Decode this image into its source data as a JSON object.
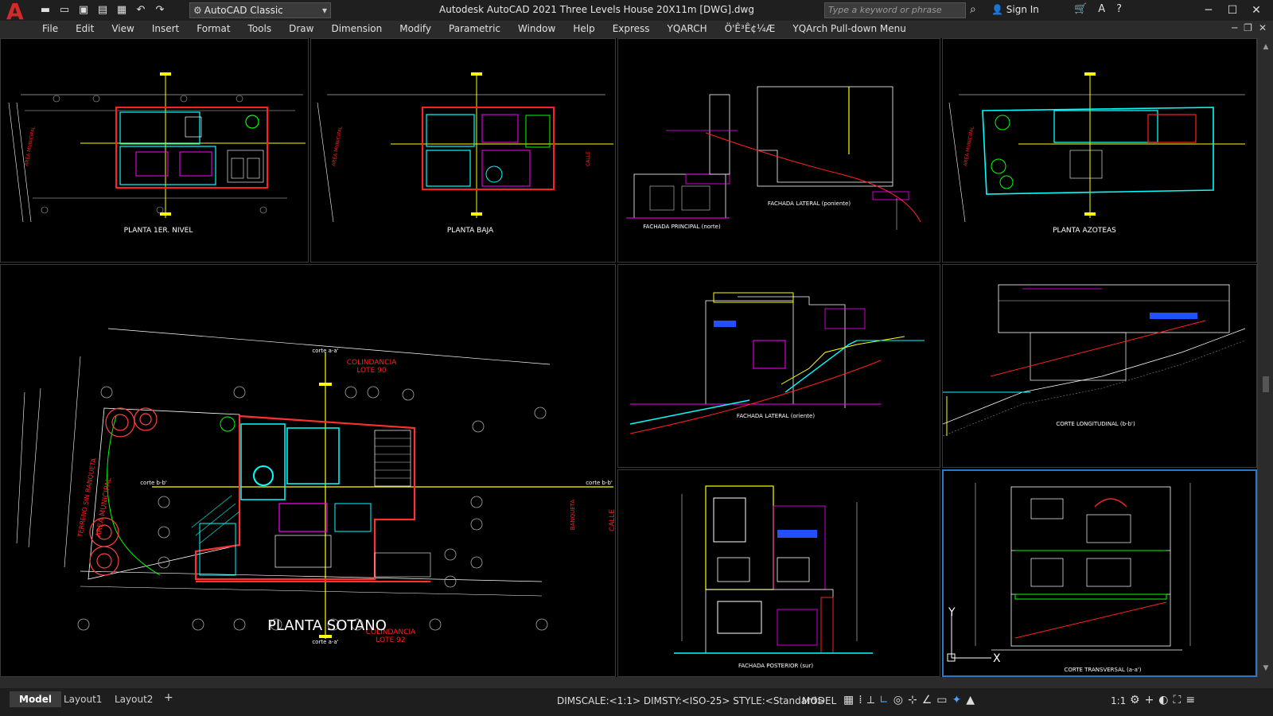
{
  "titlebar": {
    "logo": "A",
    "workspace": "AutoCAD Classic",
    "document_title": "Autodesk AutoCAD 2021    Three Levels House 20X11m [DWG].dwg",
    "search_placeholder": "Type a keyword or phrase",
    "signin": "Sign In"
  },
  "menu": [
    "File",
    "Edit",
    "View",
    "Insert",
    "Format",
    "Tools",
    "Draw",
    "Dimension",
    "Modify",
    "Parametric",
    "Window",
    "Help",
    "Express",
    "YQARCH",
    "Ö'Ê³Ê¢¼Æ",
    "YQArch Pull-down Menu"
  ],
  "viewports": {
    "vp1": {
      "title": "PLANTA 1ER. NIVEL"
    },
    "vp2": {
      "title": "PLANTA BAJA"
    },
    "vp3": {
      "title": "FACHADA PRINCIPAL (norte)",
      "title2": "FACHADA LATERAL (poniente)"
    },
    "vp4": {
      "title": "PLANTA AZOTEAS"
    },
    "vp5": {
      "title": "PLANTA SOTANO",
      "label_colindancia_top": "COLINDANCIA",
      "label_lote_top": "LOTE 90",
      "label_colindancia_bottom": "COLINDANCIA",
      "label_lote_bottom": "LOTE 92",
      "label_corte_aa_top": "corte a-a'",
      "label_corte_aa_bottom": "corte a-a'",
      "label_corte_bb_left": "corte b-b'",
      "label_corte_bb_right": "corte b-b'",
      "label_calle": "CALLE",
      "label_area": "AREA MUNICIPAL",
      "label_terreno": "TERRENO SIN BANQUETA",
      "label_banqueta": "BANQUETA"
    },
    "vp6": {
      "title": "FACHADA LATERAL (oriente)"
    },
    "vp7": {
      "title": "CORTE LONGITUDINAL (b-b')"
    },
    "vp8": {
      "title": "FACHADA POSTERIOR (sur)"
    },
    "vp9": {
      "title": "CORTE TRANSVERSAL (a-a')"
    }
  },
  "tabs": [
    "Model",
    "Layout1",
    "Layout2"
  ],
  "status": {
    "text": "DIMSCALE:<1:1> DIMSTY:<ISO-25> STYLE:<Standard>",
    "model": "MODEL",
    "scale": "1:1"
  },
  "colors": {
    "accent": "#2b78c4",
    "cyan": "#00ffff",
    "magenta": "#ff00ff",
    "yellow": "#ffff00",
    "red": "#ff2020",
    "green": "#00ff00"
  }
}
